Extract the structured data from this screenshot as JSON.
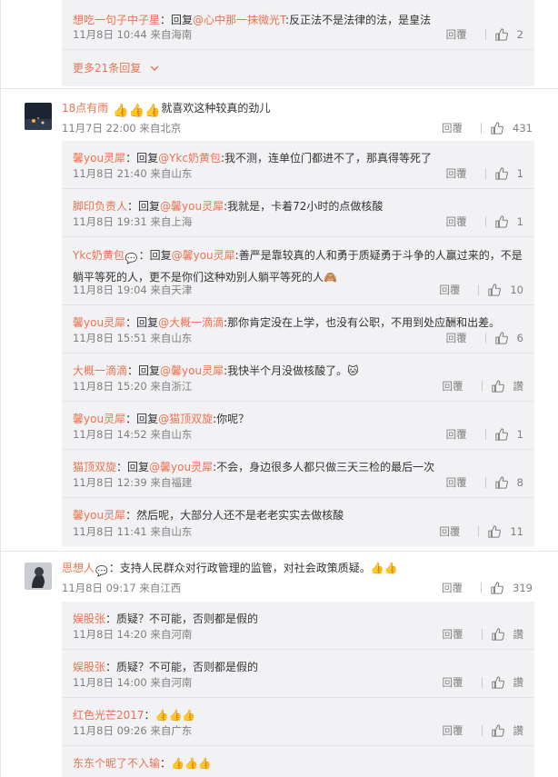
{
  "labels": {
    "reply": "回覆",
    "from": "来自",
    "more_icon": "chevron-down-icon"
  },
  "top_thread": {
    "replies": [
      {
        "user": "想吃一句子中子星",
        "reply_prefix": "：回复",
        "mention": "@心中那一抹微光T",
        "text": ":反正法不是法律的法，是皇法",
        "date": "11月8日 10:44",
        "place": "来自海南",
        "likes": "2"
      }
    ],
    "more": "更多21条回复"
  },
  "comments": [
    {
      "user": "18点有雨",
      "badge": "",
      "emojis_before": "👍👍👍",
      "text": "就喜欢这种较真的劲儿",
      "date": "11月7日 22:00",
      "place": "来自北京",
      "likes": "431",
      "replies": [
        {
          "user": "馨you灵犀",
          "reply_prefix": "：回复",
          "mention": "@Ykc奶黄包",
          "text": ":我不测，连单位门都进不了，那真得等死了",
          "date": "11月8日 21:40",
          "place": "来自山东",
          "likes": "1"
        },
        {
          "user": "脚印负责人",
          "reply_prefix": "：回复",
          "mention": "@馨you灵犀",
          "text": ":我就是，卡着72小时的点做核酸",
          "date": "11月8日 19:31",
          "place": "来自上海",
          "likes": "1"
        },
        {
          "user": "Ykc奶黄包",
          "reply_prefix": "：回复",
          "mention": "@馨you灵犀",
          "text": ":善严是靠较真的人和勇于质疑勇于斗争的人赢过来的，不是躺平等死的人，更不是你们这种劝别人躺平等死的人🙈",
          "date": "11月8日 19:04",
          "place": "来自天津",
          "likes": "10",
          "tall": true
        },
        {
          "user": "馨you灵犀",
          "reply_prefix": "：回复",
          "mention": "@大概一滴滴",
          "text": ":那你肯定没在上学，也没有公职，不用到处应酬和出差。",
          "date": "11月8日 15:51",
          "place": "来自山东",
          "likes": "6"
        },
        {
          "user": "大概一滴滴",
          "reply_prefix": "：回复",
          "mention": "@馨you灵犀",
          "text": ":我快半个月没做核酸了。🐱",
          "date": "11月8日 15:20",
          "place": "来自浙江",
          "likes": "讚"
        },
        {
          "user": "馨you灵犀",
          "reply_prefix": "：回复",
          "mention": "@猫顶双旋",
          "text": ":你呢？",
          "date": "11月8日 14:52",
          "place": "来自山东",
          "likes": "1"
        },
        {
          "user": "猫顶双旋",
          "reply_prefix": "：回复",
          "mention": "@馨you灵犀",
          "text": ":不会，身边很多人都只做三天三检的最后一次",
          "date": "11月8日 12:39",
          "place": "来自福建",
          "likes": "8"
        },
        {
          "user": "馨you灵犀",
          "reply_prefix": "",
          "mention": "",
          "text": "：然后呢，大部分人还不是老老实实去做核酸",
          "date": "11月8日 11:41",
          "place": "来自山东",
          "likes": "11"
        }
      ]
    },
    {
      "user": "思想人",
      "badge": "💬",
      "emojis_before": "",
      "text": "：支持人民群众对行政管理的监管，对社会政策质疑。👍👍",
      "date": "11月8日 09:17",
      "place": "来自江西",
      "likes": "319",
      "replies": [
        {
          "user": "娱股张",
          "reply_prefix": "",
          "mention": "",
          "text": "：质疑？不可能，否则都是假的",
          "date": "11月8日 14:20",
          "place": "来自河南",
          "likes": "讚"
        },
        {
          "user": "娱股张",
          "reply_prefix": "",
          "mention": "",
          "text": "：质疑？不可能，否则都是假的",
          "date": "11月8日 14:00",
          "place": "来自河南",
          "likes": "讚"
        },
        {
          "user": "红色光芒2017",
          "reply_prefix": "",
          "mention": "",
          "text": "：👍👍👍",
          "date": "11月8日 09:26",
          "place": "来自广东",
          "likes": "讚"
        },
        {
          "user": "东东个昵了不入输",
          "reply_prefix": "",
          "mention": "",
          "text": "：👍👍👍",
          "date": "",
          "place": "",
          "likes": ""
        }
      ]
    }
  ]
}
